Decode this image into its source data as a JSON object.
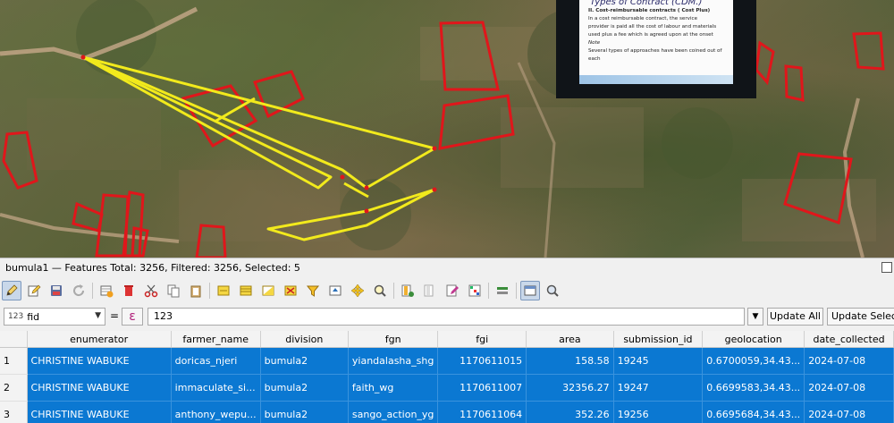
{
  "slide": {
    "heading": "Types of Contract (CDM.)",
    "lines": [
      "II. Cost-reimbursable contracts ( Cost Plus)",
      "      In a cost reimbursable contract, the service",
      "provider is paid all the cost of labour and materials",
      "used plus a fee which is agreed upon at the onset",
      "Note",
      "Several types of approaches have been coined out of",
      "each"
    ]
  },
  "panel": {
    "title": "bumula1 — Features Total: 3256, Filtered: 3256, Selected: 5"
  },
  "filter": {
    "field_type": "123",
    "field": "fid",
    "operator": "=",
    "expression_icon": "ε",
    "value": "123",
    "update_all": "Update All",
    "update_selected": "Update Selected"
  },
  "toolbar_icons": [
    "edit-pencil-icon",
    "multi-edit-icon",
    "save-icon",
    "reload-icon",
    "add-feature-icon",
    "delete-icon",
    "cut-icon",
    "copy-icon",
    "paste-icon",
    "expression-select-icon",
    "select-all-icon",
    "invert-selection-icon",
    "deselect-icon",
    "filter-icon",
    "move-top-icon",
    "pan-to-selection-icon",
    "zoom-to-selection-icon",
    "new-field-icon",
    "delete-field-icon",
    "field-calculator-icon",
    "conditional-format-icon",
    "actions-icon",
    "dock-icon",
    "zoom-icon"
  ],
  "table": {
    "columns": [
      "enumerator",
      "farmer_name",
      "division",
      "fgn",
      "fgi",
      "area",
      "submission_id",
      "geolocation",
      "date_collected"
    ],
    "rows": [
      {
        "num": "1",
        "enumerator": "CHRISTINE WABUKE",
        "farmer_name": "doricas_njeri",
        "division": "bumula2",
        "fgn": "yiandalasha_shg",
        "fgi": "1170611015",
        "area": "158.58",
        "submission_id": "19245",
        "geolocation": "0.6700059,34.43...",
        "date_collected": "2024-07-08"
      },
      {
        "num": "2",
        "enumerator": "CHRISTINE WABUKE",
        "farmer_name": "immaculate_si...",
        "division": "bumula2",
        "fgn": "faith_wg",
        "fgi": "1170611007",
        "area": "32356.27",
        "submission_id": "19247",
        "geolocation": "0.6699583,34.43...",
        "date_collected": "2024-07-08"
      },
      {
        "num": "3",
        "enumerator": "CHRISTINE WABUKE",
        "farmer_name": "anthony_wepu...",
        "division": "bumula2",
        "fgn": "sango_action_yg",
        "fgi": "1170611064",
        "area": "352.26",
        "submission_id": "19256",
        "geolocation": "0.6695684,34.43...",
        "date_collected": "2024-07-08"
      }
    ]
  },
  "colors": {
    "selection": "#0b78d2",
    "polygon_stroke": "#e0161b",
    "selected_stroke": "#f2ea1c"
  }
}
